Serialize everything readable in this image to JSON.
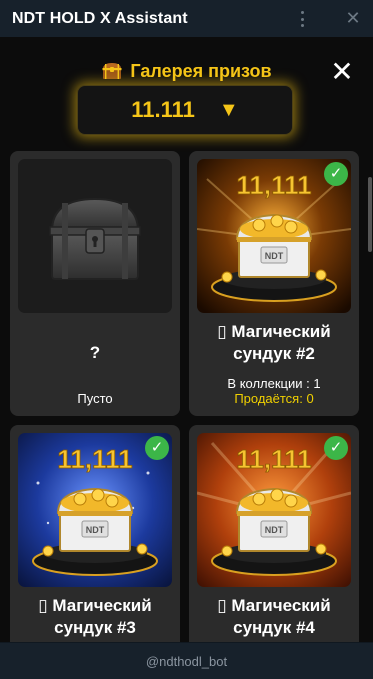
{
  "header": {
    "title": "NDT HOLD X Assistant"
  },
  "gallery": {
    "title": "Галерея призов",
    "close_label": "✕",
    "balance": "11.111",
    "balance_arrow": "▼"
  },
  "cards": [
    {
      "name": "?",
      "status": "Пусто",
      "owned": false
    },
    {
      "name_line1": "▯ Магический",
      "name_line2": "сундук #2",
      "banner": "11,111",
      "chest_label": "NDT",
      "collection": "В коллекции : 1",
      "for_sale": "Продаётся: 0",
      "owned": true,
      "theme": "dark-gold"
    },
    {
      "name_line1": "▯ Магический",
      "name_line2": "сундук #3",
      "banner": "11,111",
      "chest_label": "NDT",
      "owned": true,
      "theme": "blue"
    },
    {
      "name_line1": "▯ Магический",
      "name_line2": "сундук #4",
      "banner": "11,111",
      "chest_label": "NDT",
      "owned": true,
      "theme": "orange"
    }
  ],
  "check_mark": "✓",
  "footer": {
    "bot_handle": "@ndthodl_bot"
  },
  "colors": {
    "accent_gold": "#f5c518",
    "check_green": "#3cb648",
    "card_bg": "#2b2b2b",
    "app_bg": "#0c0c0c",
    "telegram_bg": "#17212b"
  }
}
